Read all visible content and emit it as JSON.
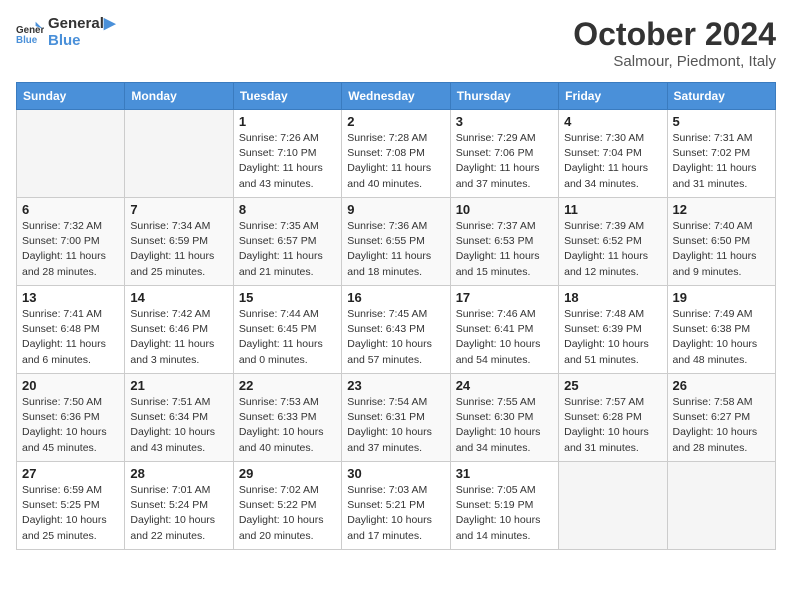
{
  "header": {
    "logo_line1": "General",
    "logo_line2": "Blue",
    "month_title": "October 2024",
    "location": "Salmour, Piedmont, Italy"
  },
  "weekdays": [
    "Sunday",
    "Monday",
    "Tuesday",
    "Wednesday",
    "Thursday",
    "Friday",
    "Saturday"
  ],
  "weeks": [
    [
      {
        "day": "",
        "empty": true
      },
      {
        "day": "",
        "empty": true
      },
      {
        "day": "1",
        "sunrise": "7:26 AM",
        "sunset": "7:10 PM",
        "daylight": "11 hours and 43 minutes."
      },
      {
        "day": "2",
        "sunrise": "7:28 AM",
        "sunset": "7:08 PM",
        "daylight": "11 hours and 40 minutes."
      },
      {
        "day": "3",
        "sunrise": "7:29 AM",
        "sunset": "7:06 PM",
        "daylight": "11 hours and 37 minutes."
      },
      {
        "day": "4",
        "sunrise": "7:30 AM",
        "sunset": "7:04 PM",
        "daylight": "11 hours and 34 minutes."
      },
      {
        "day": "5",
        "sunrise": "7:31 AM",
        "sunset": "7:02 PM",
        "daylight": "11 hours and 31 minutes."
      }
    ],
    [
      {
        "day": "6",
        "sunrise": "7:32 AM",
        "sunset": "7:00 PM",
        "daylight": "11 hours and 28 minutes."
      },
      {
        "day": "7",
        "sunrise": "7:34 AM",
        "sunset": "6:59 PM",
        "daylight": "11 hours and 25 minutes."
      },
      {
        "day": "8",
        "sunrise": "7:35 AM",
        "sunset": "6:57 PM",
        "daylight": "11 hours and 21 minutes."
      },
      {
        "day": "9",
        "sunrise": "7:36 AM",
        "sunset": "6:55 PM",
        "daylight": "11 hours and 18 minutes."
      },
      {
        "day": "10",
        "sunrise": "7:37 AM",
        "sunset": "6:53 PM",
        "daylight": "11 hours and 15 minutes."
      },
      {
        "day": "11",
        "sunrise": "7:39 AM",
        "sunset": "6:52 PM",
        "daylight": "11 hours and 12 minutes."
      },
      {
        "day": "12",
        "sunrise": "7:40 AM",
        "sunset": "6:50 PM",
        "daylight": "11 hours and 9 minutes."
      }
    ],
    [
      {
        "day": "13",
        "sunrise": "7:41 AM",
        "sunset": "6:48 PM",
        "daylight": "11 hours and 6 minutes."
      },
      {
        "day": "14",
        "sunrise": "7:42 AM",
        "sunset": "6:46 PM",
        "daylight": "11 hours and 3 minutes."
      },
      {
        "day": "15",
        "sunrise": "7:44 AM",
        "sunset": "6:45 PM",
        "daylight": "11 hours and 0 minutes."
      },
      {
        "day": "16",
        "sunrise": "7:45 AM",
        "sunset": "6:43 PM",
        "daylight": "10 hours and 57 minutes."
      },
      {
        "day": "17",
        "sunrise": "7:46 AM",
        "sunset": "6:41 PM",
        "daylight": "10 hours and 54 minutes."
      },
      {
        "day": "18",
        "sunrise": "7:48 AM",
        "sunset": "6:39 PM",
        "daylight": "10 hours and 51 minutes."
      },
      {
        "day": "19",
        "sunrise": "7:49 AM",
        "sunset": "6:38 PM",
        "daylight": "10 hours and 48 minutes."
      }
    ],
    [
      {
        "day": "20",
        "sunrise": "7:50 AM",
        "sunset": "6:36 PM",
        "daylight": "10 hours and 45 minutes."
      },
      {
        "day": "21",
        "sunrise": "7:51 AM",
        "sunset": "6:34 PM",
        "daylight": "10 hours and 43 minutes."
      },
      {
        "day": "22",
        "sunrise": "7:53 AM",
        "sunset": "6:33 PM",
        "daylight": "10 hours and 40 minutes."
      },
      {
        "day": "23",
        "sunrise": "7:54 AM",
        "sunset": "6:31 PM",
        "daylight": "10 hours and 37 minutes."
      },
      {
        "day": "24",
        "sunrise": "7:55 AM",
        "sunset": "6:30 PM",
        "daylight": "10 hours and 34 minutes."
      },
      {
        "day": "25",
        "sunrise": "7:57 AM",
        "sunset": "6:28 PM",
        "daylight": "10 hours and 31 minutes."
      },
      {
        "day": "26",
        "sunrise": "7:58 AM",
        "sunset": "6:27 PM",
        "daylight": "10 hours and 28 minutes."
      }
    ],
    [
      {
        "day": "27",
        "sunrise": "6:59 AM",
        "sunset": "5:25 PM",
        "daylight": "10 hours and 25 minutes."
      },
      {
        "day": "28",
        "sunrise": "7:01 AM",
        "sunset": "5:24 PM",
        "daylight": "10 hours and 22 minutes."
      },
      {
        "day": "29",
        "sunrise": "7:02 AM",
        "sunset": "5:22 PM",
        "daylight": "10 hours and 20 minutes."
      },
      {
        "day": "30",
        "sunrise": "7:03 AM",
        "sunset": "5:21 PM",
        "daylight": "10 hours and 17 minutes."
      },
      {
        "day": "31",
        "sunrise": "7:05 AM",
        "sunset": "5:19 PM",
        "daylight": "10 hours and 14 minutes."
      },
      {
        "day": "",
        "empty": true
      },
      {
        "day": "",
        "empty": true
      }
    ]
  ]
}
